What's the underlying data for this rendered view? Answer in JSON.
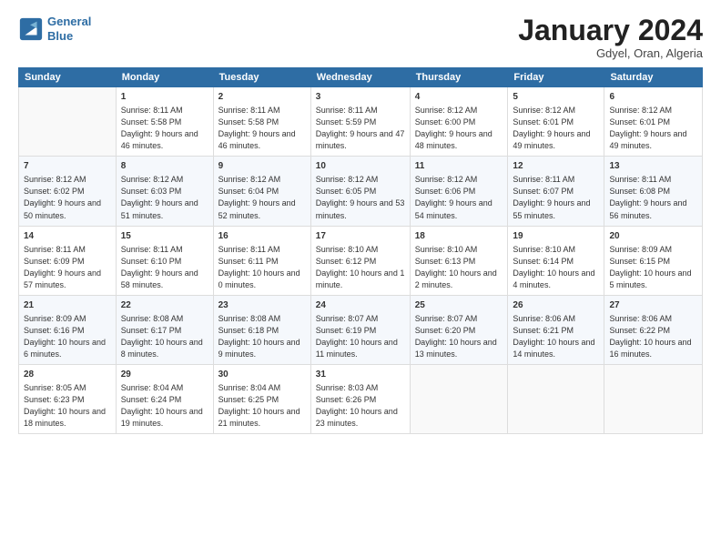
{
  "header": {
    "logo_line1": "General",
    "logo_line2": "Blue",
    "month_title": "January 2024",
    "location": "Gdyel, Oran, Algeria"
  },
  "days_of_week": [
    "Sunday",
    "Monday",
    "Tuesday",
    "Wednesday",
    "Thursday",
    "Friday",
    "Saturday"
  ],
  "weeks": [
    [
      {
        "num": "",
        "sunrise": "",
        "sunset": "",
        "daylight": ""
      },
      {
        "num": "1",
        "sunrise": "8:11 AM",
        "sunset": "5:58 PM",
        "daylight": "9 hours and 46 minutes."
      },
      {
        "num": "2",
        "sunrise": "8:11 AM",
        "sunset": "5:58 PM",
        "daylight": "9 hours and 46 minutes."
      },
      {
        "num": "3",
        "sunrise": "8:11 AM",
        "sunset": "5:59 PM",
        "daylight": "9 hours and 47 minutes."
      },
      {
        "num": "4",
        "sunrise": "8:12 AM",
        "sunset": "6:00 PM",
        "daylight": "9 hours and 48 minutes."
      },
      {
        "num": "5",
        "sunrise": "8:12 AM",
        "sunset": "6:01 PM",
        "daylight": "9 hours and 49 minutes."
      },
      {
        "num": "6",
        "sunrise": "8:12 AM",
        "sunset": "6:01 PM",
        "daylight": "9 hours and 49 minutes."
      }
    ],
    [
      {
        "num": "7",
        "sunrise": "8:12 AM",
        "sunset": "6:02 PM",
        "daylight": "9 hours and 50 minutes."
      },
      {
        "num": "8",
        "sunrise": "8:12 AM",
        "sunset": "6:03 PM",
        "daylight": "9 hours and 51 minutes."
      },
      {
        "num": "9",
        "sunrise": "8:12 AM",
        "sunset": "6:04 PM",
        "daylight": "9 hours and 52 minutes."
      },
      {
        "num": "10",
        "sunrise": "8:12 AM",
        "sunset": "6:05 PM",
        "daylight": "9 hours and 53 minutes."
      },
      {
        "num": "11",
        "sunrise": "8:12 AM",
        "sunset": "6:06 PM",
        "daylight": "9 hours and 54 minutes."
      },
      {
        "num": "12",
        "sunrise": "8:11 AM",
        "sunset": "6:07 PM",
        "daylight": "9 hours and 55 minutes."
      },
      {
        "num": "13",
        "sunrise": "8:11 AM",
        "sunset": "6:08 PM",
        "daylight": "9 hours and 56 minutes."
      }
    ],
    [
      {
        "num": "14",
        "sunrise": "8:11 AM",
        "sunset": "6:09 PM",
        "daylight": "9 hours and 57 minutes."
      },
      {
        "num": "15",
        "sunrise": "8:11 AM",
        "sunset": "6:10 PM",
        "daylight": "9 hours and 58 minutes."
      },
      {
        "num": "16",
        "sunrise": "8:11 AM",
        "sunset": "6:11 PM",
        "daylight": "10 hours and 0 minutes."
      },
      {
        "num": "17",
        "sunrise": "8:10 AM",
        "sunset": "6:12 PM",
        "daylight": "10 hours and 1 minute."
      },
      {
        "num": "18",
        "sunrise": "8:10 AM",
        "sunset": "6:13 PM",
        "daylight": "10 hours and 2 minutes."
      },
      {
        "num": "19",
        "sunrise": "8:10 AM",
        "sunset": "6:14 PM",
        "daylight": "10 hours and 4 minutes."
      },
      {
        "num": "20",
        "sunrise": "8:09 AM",
        "sunset": "6:15 PM",
        "daylight": "10 hours and 5 minutes."
      }
    ],
    [
      {
        "num": "21",
        "sunrise": "8:09 AM",
        "sunset": "6:16 PM",
        "daylight": "10 hours and 6 minutes."
      },
      {
        "num": "22",
        "sunrise": "8:08 AM",
        "sunset": "6:17 PM",
        "daylight": "10 hours and 8 minutes."
      },
      {
        "num": "23",
        "sunrise": "8:08 AM",
        "sunset": "6:18 PM",
        "daylight": "10 hours and 9 minutes."
      },
      {
        "num": "24",
        "sunrise": "8:07 AM",
        "sunset": "6:19 PM",
        "daylight": "10 hours and 11 minutes."
      },
      {
        "num": "25",
        "sunrise": "8:07 AM",
        "sunset": "6:20 PM",
        "daylight": "10 hours and 13 minutes."
      },
      {
        "num": "26",
        "sunrise": "8:06 AM",
        "sunset": "6:21 PM",
        "daylight": "10 hours and 14 minutes."
      },
      {
        "num": "27",
        "sunrise": "8:06 AM",
        "sunset": "6:22 PM",
        "daylight": "10 hours and 16 minutes."
      }
    ],
    [
      {
        "num": "28",
        "sunrise": "8:05 AM",
        "sunset": "6:23 PM",
        "daylight": "10 hours and 18 minutes."
      },
      {
        "num": "29",
        "sunrise": "8:04 AM",
        "sunset": "6:24 PM",
        "daylight": "10 hours and 19 minutes."
      },
      {
        "num": "30",
        "sunrise": "8:04 AM",
        "sunset": "6:25 PM",
        "daylight": "10 hours and 21 minutes."
      },
      {
        "num": "31",
        "sunrise": "8:03 AM",
        "sunset": "6:26 PM",
        "daylight": "10 hours and 23 minutes."
      },
      {
        "num": "",
        "sunrise": "",
        "sunset": "",
        "daylight": ""
      },
      {
        "num": "",
        "sunrise": "",
        "sunset": "",
        "daylight": ""
      },
      {
        "num": "",
        "sunrise": "",
        "sunset": "",
        "daylight": ""
      }
    ]
  ]
}
